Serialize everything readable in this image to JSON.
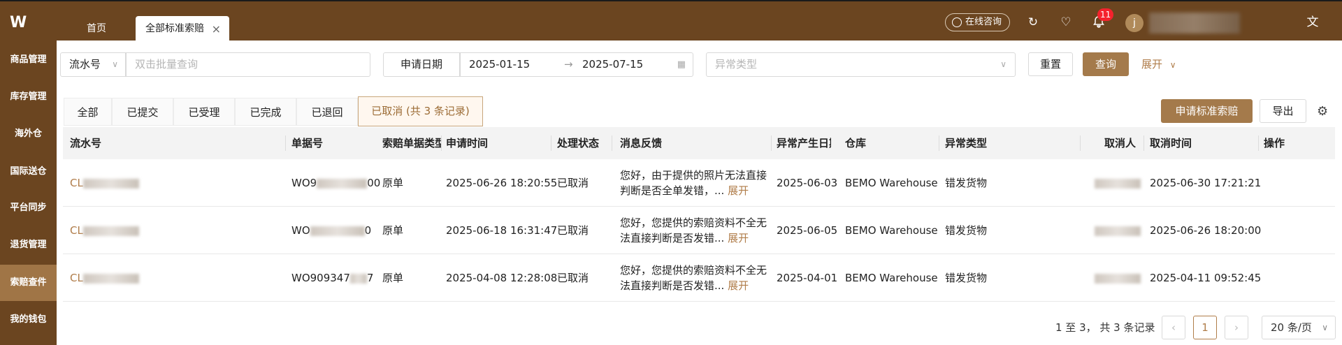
{
  "topbar": {
    "logo": "W",
    "tabs": [
      {
        "label": "首页"
      },
      {
        "label": "全部标准索赔"
      }
    ],
    "consult_label": "在线咨询",
    "notification_count": "11",
    "avatar_letter": "j"
  },
  "sidebar": {
    "items": [
      {
        "label": "商品管理"
      },
      {
        "label": "库存管理"
      },
      {
        "label": "海外仓"
      },
      {
        "label": "国际送仓"
      },
      {
        "label": "平台同步"
      },
      {
        "label": "退货管理"
      },
      {
        "label": "索赔查件"
      },
      {
        "label": "我的钱包"
      }
    ]
  },
  "filters": {
    "id_type": "流水号",
    "batch_placeholder": "双击批量查询",
    "date_label": "申请日期",
    "date_start": "2025-01-15",
    "date_end": "2025-07-15",
    "exception_placeholder": "异常类型",
    "reset": "重置",
    "search": "查询",
    "expand": "展开"
  },
  "status_tabs": [
    {
      "label": "全部"
    },
    {
      "label": "已提交"
    },
    {
      "label": "已受理"
    },
    {
      "label": "已完成"
    },
    {
      "label": "已退回"
    },
    {
      "label": "已取消 (共 3 条记录)"
    }
  ],
  "actions": {
    "apply": "申请标准索赔",
    "export": "导出"
  },
  "table": {
    "headers": [
      "流水号",
      "单据号",
      "索赔单据类型",
      "申请时间",
      "处理状态",
      "消息反馈",
      "异常产生日期",
      "仓库",
      "异常类型",
      "取消人",
      "取消时间",
      "操作"
    ],
    "rows": [
      {
        "serial": "CL",
        "doc": "WO9",
        "doc_suffix": "00",
        "doc_type": "原单",
        "apply_time": "2025-06-26 18:20:55",
        "status": "已取消",
        "feedback": "您好，由于提供的照片无法直接判断是否全单发错，...",
        "expand": "展开",
        "exc_date": "2025-06-03",
        "warehouse": "BEMO Warehouse",
        "exc_type": "错发货物",
        "cancel_time": "2025-06-30 17:21:21"
      },
      {
        "serial": "CL",
        "doc": "WO",
        "doc_suffix": "0",
        "doc_type": "原单",
        "apply_time": "2025-06-18 16:31:47",
        "status": "已取消",
        "feedback": "您好，您提供的索赔资料不全无法直接判断是否发错...",
        "expand": "展开",
        "exc_date": "2025-06-05",
        "warehouse": "BEMO Warehouse",
        "exc_type": "错发货物",
        "cancel_time": "2025-06-26 18:20:00"
      },
      {
        "serial": "CL",
        "doc": "WO909347",
        "doc_suffix": "7",
        "doc_type": "原单",
        "apply_time": "2025-04-08 12:28:08",
        "status": "已取消",
        "feedback": "您好，您提供的索赔资料不全无法直接判断是否发错...",
        "expand": "展开",
        "exc_date": "2025-04-01",
        "warehouse": "BEMO Warehouse",
        "exc_type": "错发货物",
        "cancel_time": "2025-04-11 09:52:45"
      }
    ]
  },
  "pagination": {
    "summary": "1 至 3， 共 3 条记录",
    "current": "1",
    "page_size": "20 条/页"
  },
  "colors": {
    "brand": "#6b4520",
    "accent": "#a47a4b",
    "link": "#b07d4a"
  }
}
